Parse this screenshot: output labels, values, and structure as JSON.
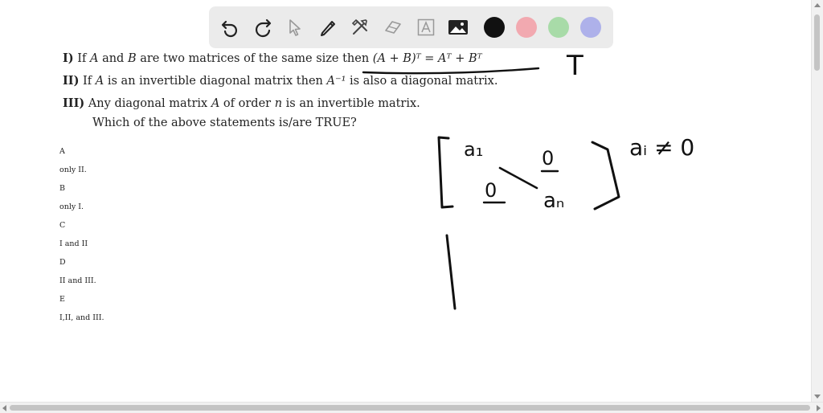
{
  "toolbar": {
    "tools": [
      {
        "name": "undo-icon"
      },
      {
        "name": "redo-icon"
      },
      {
        "name": "select-pointer-icon"
      },
      {
        "name": "pen-icon"
      },
      {
        "name": "tools-icon"
      },
      {
        "name": "eraser-icon"
      },
      {
        "name": "text-icon"
      },
      {
        "name": "image-icon"
      }
    ],
    "colors": [
      "#111111",
      "#f2a9b0",
      "#a8dba8",
      "#aeb1ea"
    ]
  },
  "question": {
    "s1": {
      "label": "I)",
      "p1": "If",
      "var_a": "A",
      "p2": "and",
      "var_b": "B",
      "p3": "are two matrices of the same size then",
      "formula": "(A + B)ᵀ = Aᵀ + Bᵀ"
    },
    "s2": {
      "label": "II)",
      "p1": "If",
      "var_a": "A",
      "p2": "is an invertible diagonal matrix then",
      "inverse": "A⁻¹",
      "p3": "is also a diagonal matrix."
    },
    "s3": {
      "label": "III)",
      "p1": "Any diagonal matrix",
      "var_a": "A",
      "p2": "of order",
      "var_n": "n",
      "p3": "is an invertible matrix."
    },
    "prompt": "Which of the above statements is/are TRUE?"
  },
  "options": [
    {
      "letter": "A",
      "text": "only II."
    },
    {
      "letter": "B",
      "text": "only I."
    },
    {
      "letter": "C",
      "text": "I and II"
    },
    {
      "letter": "D",
      "text": "II and III."
    },
    {
      "letter": "E",
      "text": "I,II, and III."
    }
  ],
  "handwriting": {
    "t_mark": "T",
    "a1": "a₁",
    "zero_top": "0",
    "zero_bottom": "0",
    "an": "aₙ",
    "condition": "aᵢ ≠ 0"
  }
}
